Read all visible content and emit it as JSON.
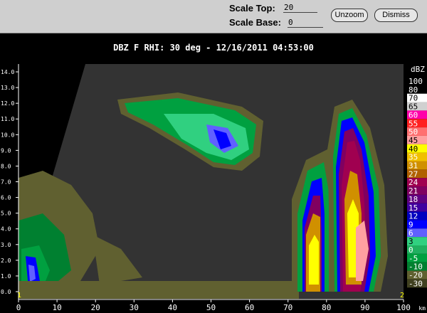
{
  "toolbar": {
    "scale_top_label": "Scale Top:",
    "scale_top_value": "20",
    "scale_base_label": "Scale Base:",
    "scale_base_value": "0",
    "unzoom_label": "Unzoom",
    "dismiss_label": "Dismiss"
  },
  "plot": {
    "title": "DBZ F  RHI: 30 deg  -  12/16/2011 04:53:00",
    "y_ticks": [
      "0.0",
      "1.0",
      "2.0",
      "3.0",
      "4.0",
      "5.0",
      "6.0",
      "7.0",
      "8.0",
      "9.0",
      "10.0",
      "11.0",
      "12.0",
      "13.0",
      "14.0"
    ],
    "x_ticks": [
      "0",
      "10",
      "20",
      "30",
      "40",
      "50",
      "60",
      "70",
      "80",
      "90",
      "100"
    ],
    "x_unit": "km",
    "corner_markers": [
      "1",
      "2"
    ]
  },
  "legend": {
    "unit": "dBZ",
    "entries": [
      {
        "label": "100",
        "color": "#000000"
      },
      {
        "label": "80",
        "color": "#000000"
      },
      {
        "label": "70",
        "color": "#ffffff"
      },
      {
        "label": "65",
        "color": "#d0d0d0"
      },
      {
        "label": "60",
        "color": "#ff00aa"
      },
      {
        "label": "55",
        "color": "#ff2020"
      },
      {
        "label": "50",
        "color": "#ff7070"
      },
      {
        "label": "45",
        "color": "#ffa0a0"
      },
      {
        "label": "40",
        "color": "#ffff00"
      },
      {
        "label": "35",
        "color": "#f0c000"
      },
      {
        "label": "31",
        "color": "#d09000"
      },
      {
        "label": "27",
        "color": "#b06000"
      },
      {
        "label": "24",
        "color": "#a00050"
      },
      {
        "label": "21",
        "color": "#800060"
      },
      {
        "label": "18",
        "color": "#600080"
      },
      {
        "label": "15",
        "color": "#4000a0"
      },
      {
        "label": "12",
        "color": "#0000c0"
      },
      {
        "label": "9",
        "color": "#0000ff"
      },
      {
        "label": "6",
        "color": "#6060ff"
      },
      {
        "label": "3",
        "color": "#30d080"
      },
      {
        "label": "0",
        "color": "#20b060"
      },
      {
        "label": "-5",
        "color": "#00a040"
      },
      {
        "label": "-10",
        "color": "#008030"
      },
      {
        "label": "-20",
        "color": "#606030"
      },
      {
        "label": "-30",
        "color": "#404020"
      }
    ]
  }
}
